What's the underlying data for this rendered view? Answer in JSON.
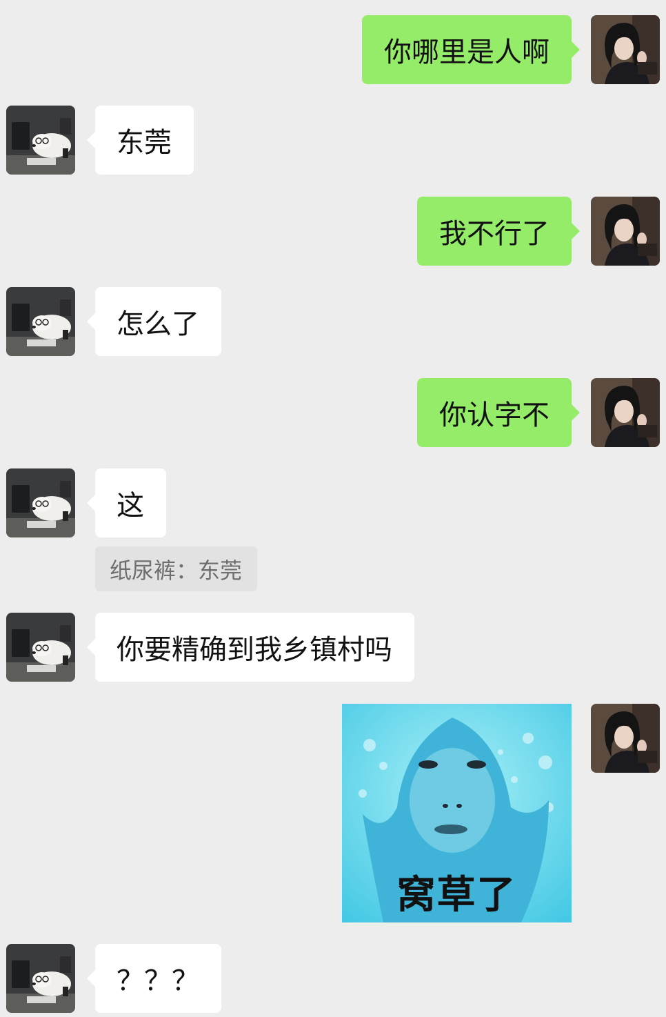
{
  "messages": [
    {
      "side": "right",
      "text": "你哪里是人啊"
    },
    {
      "side": "left",
      "text": "东莞"
    },
    {
      "side": "right",
      "text": "我不行了"
    },
    {
      "side": "left",
      "text": "怎么了"
    },
    {
      "side": "right",
      "text": "你认字不"
    },
    {
      "side": "left",
      "text": "这",
      "quote": "纸尿裤：东莞"
    },
    {
      "side": "left",
      "text": "你要精确到我乡镇村吗"
    },
    {
      "side": "right",
      "type": "sticker",
      "caption": "窝草了"
    },
    {
      "side": "left",
      "text": "？？？"
    }
  ],
  "colors": {
    "background": "#ededed",
    "sent_bubble": "#95ec69",
    "received_bubble": "#ffffff",
    "quote_bg": "#e2e2e2"
  },
  "icons": {
    "self_avatar": "girl-portrait-avatar",
    "other_avatar": "dog-with-glasses-avatar"
  }
}
